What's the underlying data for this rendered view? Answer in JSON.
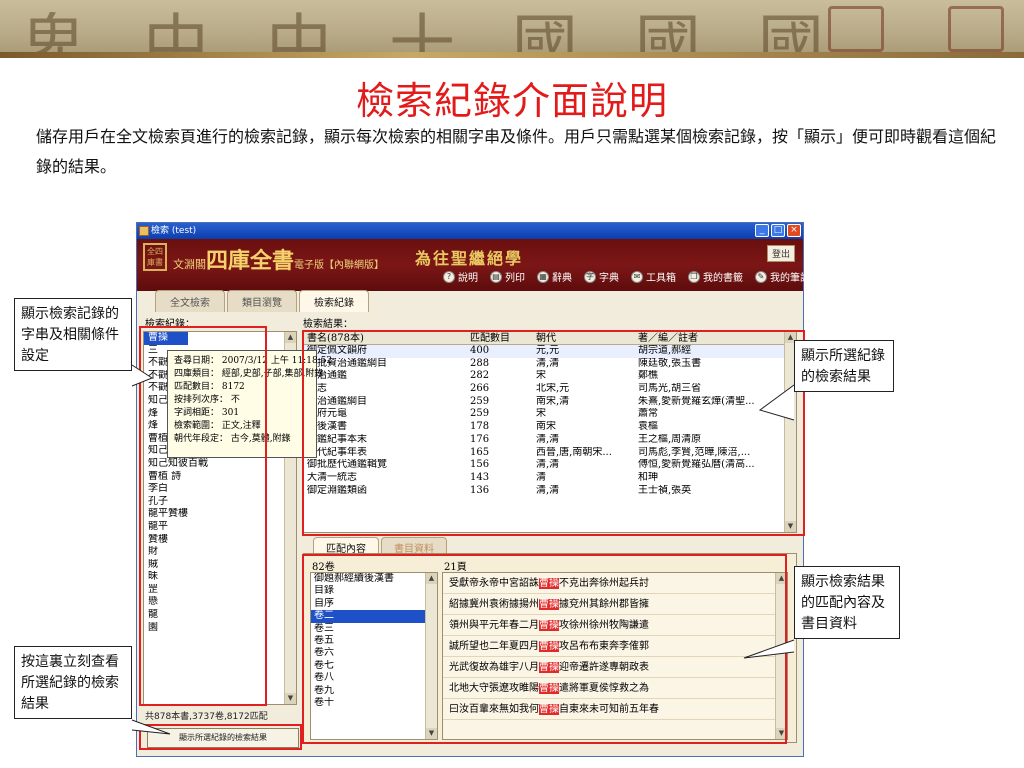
{
  "slide": {
    "title": "檢索紀錄介面說明",
    "description": "儲存用戶在全文檢索頁進行的檢索記錄，顯示每次檢索的相關字串及條件。用戶只需點選某個檢索記錄，按「顯示」便可即時觀看這個紀錄的結果。"
  },
  "window": {
    "title": "檢索 (test)",
    "controls": [
      "_",
      "□",
      "×"
    ]
  },
  "app_header": {
    "logo_text": "全四庫書",
    "brand_prefix": "文淵閣",
    "brand_main": "四庫全書",
    "brand_suffix": "電子版【內聯網版】",
    "motto": "為往聖繼絕學",
    "exit_label": "登出",
    "toolbar": [
      {
        "label": "說明",
        "icon": "help-icon"
      },
      {
        "label": "列印",
        "icon": "print-icon"
      },
      {
        "label": "辭典",
        "icon": "dictionary-icon"
      },
      {
        "label": "字典",
        "icon": "character-dictionary-icon"
      },
      {
        "label": "工具箱",
        "icon": "toolbox-icon"
      },
      {
        "label": "我的書籤",
        "icon": "bookmark-icon"
      },
      {
        "label": "我的筆記",
        "icon": "notes-icon"
      }
    ]
  },
  "tabs": [
    {
      "label": "全文檢索",
      "active": false
    },
    {
      "label": "類目瀏覽",
      "active": false
    },
    {
      "label": "檢索紀錄",
      "active": true
    }
  ],
  "records": {
    "label": "檢索紀錄：",
    "items": [
      "曹操",
      "三",
      "不觀",
      "不觀",
      "不觀",
      "知己",
      "烽",
      "烽",
      "曹植",
      "知己知彼百戰",
      "知己知彼百戰",
      "曹植 詩",
      "李白",
      "孔子",
      "龍平贊樓",
      "龍平",
      "贊樓",
      "財",
      "賊",
      "昧",
      "罡",
      "懸",
      "龍",
      "園"
    ],
    "status": "共878本書,3737卷,8172匹配",
    "show_button": "顯示所選紀錄的檢索結果"
  },
  "tooltip": [
    "查尋日期： 2007/3/12 上午 11:18:52",
    "四庫類目： 經部,史部,子部,集部,附錄",
    "匹配數目： 8172",
    "按排列次序： 不",
    "字詞相距： 301",
    "檢索範圍： 正文,注釋",
    "朝代年段定： 古今,莫體,附錄"
  ],
  "results": {
    "label": "檢索結果：",
    "columns": [
      "書名(878本)",
      "匹配數目",
      "朝代",
      "著／編／註者"
    ],
    "rows": [
      [
        "御定佩文韻府",
        "400",
        "元,元",
        "胡宗道,郝經"
      ],
      [
        "御批資治通鑑綱目",
        "288",
        "清,清",
        "陳廷敬,張玉書"
      ],
      [
        "資治通鑑",
        "282",
        "宋",
        "鄭樵"
      ],
      [
        "通志",
        "266",
        "北宋,元",
        "司馬光,胡三省"
      ],
      [
        "資治通鑑綱目",
        "259",
        "南宋,清",
        "朱熹,愛新覺羅玄燁(清聖..."
      ],
      [
        "冊府元龜",
        "259",
        "宋",
        "蕭常"
      ],
      [
        "續後漢書",
        "178",
        "南宋",
        "袁樞"
      ],
      [
        "通鑑紀事本末",
        "176",
        "清,清",
        "王之樞,周清原"
      ],
      [
        "歷代紀事年表",
        "165",
        "西晉,唐,南朝宋...",
        "司馬彪,李賢,范曄,陳涪,..."
      ],
      [
        "御批歷代通鑑輯覽",
        "156",
        "清,清",
        "傅恒,愛新覺羅弘曆(清高..."
      ],
      [
        "大清一統志",
        "143",
        "清",
        "和珅"
      ],
      [
        "御定淵鑑類函",
        "136",
        "清,清",
        "王士禎,張英"
      ]
    ]
  },
  "detail": {
    "tabs": [
      {
        "label": "匹配內容",
        "active": true
      },
      {
        "label": "書目資料",
        "active": false
      }
    ],
    "volume_count": "82卷",
    "page_count": "21頁",
    "volumes": [
      "御題郝經續後漢書",
      "目錄",
      "自序",
      "卷二",
      "卷三",
      "卷五",
      "卷六",
      "卷七",
      "卷八",
      "卷九",
      "卷十"
    ],
    "selected_volume_index": 3,
    "lines": [
      {
        "before": "受獻帝永帝中宮詔誅",
        "match": "曹操",
        "after": "不克出奔徐州起兵討"
      },
      {
        "before": "紹據冀州袁術據揚州",
        "match": "曹操",
        "after": "據兗州其餘州郡皆擁"
      },
      {
        "before": "領州與平元年春二月",
        "match": "曹操",
        "after": "攻徐州徐州牧陶謙遣"
      },
      {
        "before": "誠所望也二年夏四月",
        "match": "曹操",
        "after": "攻呂布布東奔李傕郭"
      },
      {
        "before": "光武復故為雄宇八月",
        "match": "曹操",
        "after": "迎帝遷許遂專朝政表"
      },
      {
        "before": "北地大守張遼攻睢陽",
        "match": "曹操",
        "after": "遣將軍夏侯惇救之為"
      },
      {
        "before": "曰汝百輩來無如我何",
        "match": "曹操",
        "after": "自東來未可知前五年春"
      }
    ]
  },
  "callouts": [
    "顯示檢索記錄的字串及相關條件設定",
    "顯示所選紀錄的檢索結果",
    "顯示檢索結果的匹配內容及書目資料",
    "按這裏立刻查看所選紀錄的檢索結果"
  ],
  "colors": {
    "title_red": "#e21a1a",
    "header_maroon": "#6a0f0f",
    "highlight_red": "#e02020",
    "selection_blue": "#1e50c8"
  }
}
